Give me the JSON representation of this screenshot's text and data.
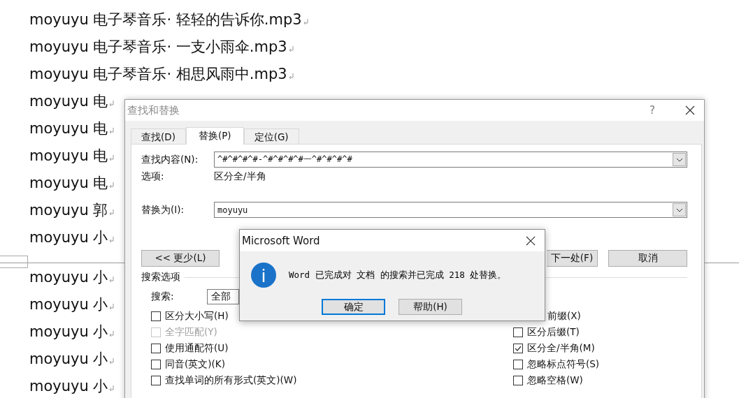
{
  "document": {
    "pages": [
      {
        "lines": [
          "moyuyu 电子琴音乐· 轻轻的告诉你.mp3",
          "moyuyu 电子琴音乐· 一支小雨伞.mp3",
          "moyuyu 电子琴音乐· 相思风雨中.mp3",
          "moyuyu 电",
          "moyuyu 电",
          "moyuyu 电",
          "moyuyu 电",
          "moyuyu 郭",
          "moyuyu 小"
        ]
      },
      {
        "lines": [
          "moyuyu 小",
          "moyuyu 小",
          "moyuyu 小",
          "moyuyu 小",
          "moyuyu 小"
        ]
      }
    ]
  },
  "find_dialog": {
    "title": "查找和替换",
    "help": "?",
    "tabs": [
      {
        "label": "查找(D)",
        "selected": false
      },
      {
        "label": "替换(P)",
        "selected": true
      },
      {
        "label": "定位(G)",
        "selected": false
      }
    ],
    "find_what": {
      "label": "查找内容(N):",
      "value": "^#^#^#^#-^#^#^#^#一^#^#^#^#"
    },
    "options": {
      "label": "选项:",
      "value": "区分全/半角"
    },
    "replace_with": {
      "label": "替换为(I):",
      "value": "moyuyu"
    },
    "less_button": "<< 更少(L)",
    "buttons": [
      "下一处(F)",
      "取消"
    ],
    "search_options": {
      "title": "搜索选项",
      "search_label": "搜索:",
      "search_value": "全部",
      "left": [
        {
          "kind": "checkbox",
          "label": "区分大小写(H)",
          "checked": false,
          "disabled": false
        },
        {
          "kind": "checkbox",
          "label": "全字匹配(Y)",
          "checked": false,
          "disabled": true
        },
        {
          "kind": "checkbox",
          "label": "使用通配符(U)",
          "checked": false,
          "disabled": false
        },
        {
          "kind": "checkbox",
          "label": "同音(英文)(K)",
          "checked": false,
          "disabled": false
        },
        {
          "kind": "checkbox",
          "label": "查找单词的所有形式(英文)(W)",
          "checked": false,
          "disabled": false
        }
      ],
      "right": [
        {
          "kind": "cut",
          "label": "前缀(X)"
        },
        {
          "kind": "checkbox",
          "label": "区分后缀(T)",
          "checked": false,
          "disabled": false
        },
        {
          "kind": "checkbox",
          "label": "区分全/半角(M)",
          "checked": true,
          "disabled": false
        },
        {
          "kind": "checkbox",
          "label": "忽略标点符号(S)",
          "checked": false,
          "disabled": false
        },
        {
          "kind": "checkbox",
          "label": "忽略空格(W)",
          "checked": false,
          "disabled": false
        }
      ]
    }
  },
  "message_box": {
    "title": "Microsoft Word",
    "message": "Word 已完成对 文档 的搜索并已完成 218 处替换。",
    "buttons": [
      {
        "label": "确定",
        "default": true
      },
      {
        "label": "帮助(H)",
        "default": false
      }
    ]
  }
}
